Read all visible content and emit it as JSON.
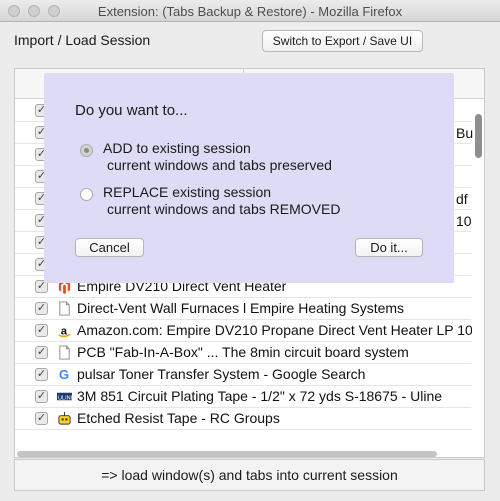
{
  "window": {
    "title": "Extension: (Tabs Backup & Restore) - Mozilla Firefox"
  },
  "header": {
    "heading": "Import / Load Session",
    "switch_button": "Switch to Export / Save UI"
  },
  "list": {
    "rows": [
      {
        "title": "",
        "icon": "blank",
        "checked": true
      },
      {
        "title": "",
        "icon": "blank",
        "checked": true,
        "tail": "Bu"
      },
      {
        "title": "",
        "icon": "blank",
        "checked": true
      },
      {
        "title": "",
        "icon": "blank",
        "checked": true
      },
      {
        "title": "",
        "icon": "blank",
        "checked": true,
        "tail": "df"
      },
      {
        "title": "",
        "icon": "blank",
        "checked": true,
        "tail": "10"
      },
      {
        "title": "",
        "icon": "blank",
        "checked": true
      },
      {
        "title": "",
        "icon": "blank",
        "checked": true
      },
      {
        "title": "Empire DV210 Direct Vent Heater",
        "icon": "magento-icon",
        "checked": true
      },
      {
        "title": "Direct-Vent Wall Furnaces l Empire Heating Systems",
        "icon": "page-icon",
        "checked": true
      },
      {
        "title": "Amazon.com: Empire DV210 Propane Direct Vent Heater LP 10",
        "icon": "amazon-icon",
        "checked": true
      },
      {
        "title": "PCB \"Fab-In-A-Box\" ... The 8min circuit board system",
        "icon": "page-icon",
        "checked": true
      },
      {
        "title": "pulsar Toner Transfer System - Google Search",
        "icon": "google-icon",
        "checked": true
      },
      {
        "title": "3M 851 Circuit Plating Tape - 1/2\" x 72 yds S-18675 - Uline",
        "icon": "uline-icon",
        "checked": true
      },
      {
        "title": "Etched Resist Tape - RC Groups",
        "icon": "rcgroups-icon",
        "checked": true
      }
    ]
  },
  "footer": {
    "load_label": "=>  load window(s) and tabs into current session"
  },
  "dialog": {
    "prompt": "Do you want to...",
    "options": [
      {
        "label": "ADD to existing session",
        "sub": "current windows and tabs preserved",
        "selected": true
      },
      {
        "label": "REPLACE existing session",
        "sub": "current windows and tabs REMOVED",
        "selected": false
      }
    ],
    "cancel": "Cancel",
    "confirm": "Do it..."
  },
  "colors": {
    "dialog_bg": "#dedbf6",
    "window_bg": "#ececec"
  }
}
